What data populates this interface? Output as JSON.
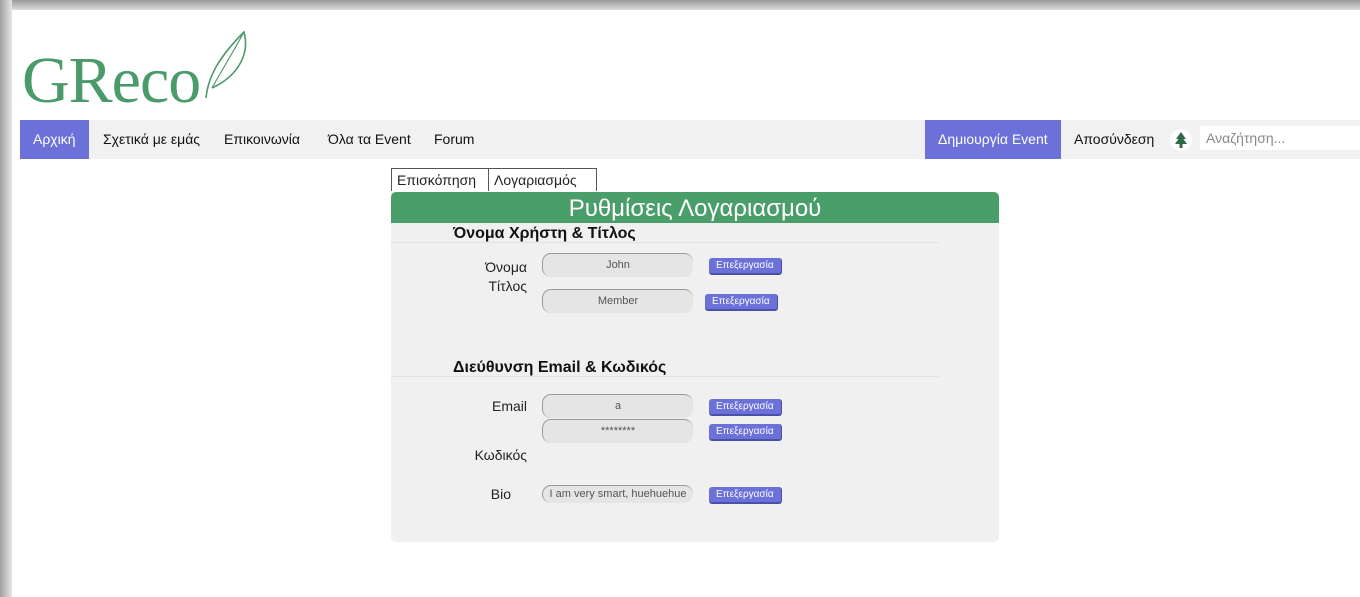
{
  "logo": {
    "text": "GReco"
  },
  "nav": {
    "home": "Αρχική",
    "about": "Σχετικά με εμάς",
    "contact": "Επικοινωνία",
    "events": "Όλα τα Event",
    "forum": "Forum",
    "create_event": "Δημιουργία Event",
    "logout": "Αποσύνδεση",
    "search_placeholder": "Αναζήτηση..."
  },
  "tabs": {
    "overview": "Επισκόπηση",
    "account": "Λογαριασμός"
  },
  "panel": {
    "title": "Ρυθμίσεις Λογαριασμού",
    "sections": {
      "username": {
        "title": "Όνομα Χρήστη & Τίτλος",
        "name_label": "Όνομα",
        "name_value": "John",
        "title_label": "Τίτλος",
        "title_value": "Member"
      },
      "email": {
        "title": "Διεύθυνση Email & Κωδικός",
        "email_label": "Email",
        "email_value": "a",
        "password_label": "Κωδικός",
        "password_value": "********",
        "bio_label": "Bio",
        "bio_value": "I am very smart, huehuehue"
      }
    },
    "edit_label": "Επεξεργασία"
  },
  "colors": {
    "brand_green": "#4a9e6a",
    "accent_blue": "#6b71d8"
  }
}
